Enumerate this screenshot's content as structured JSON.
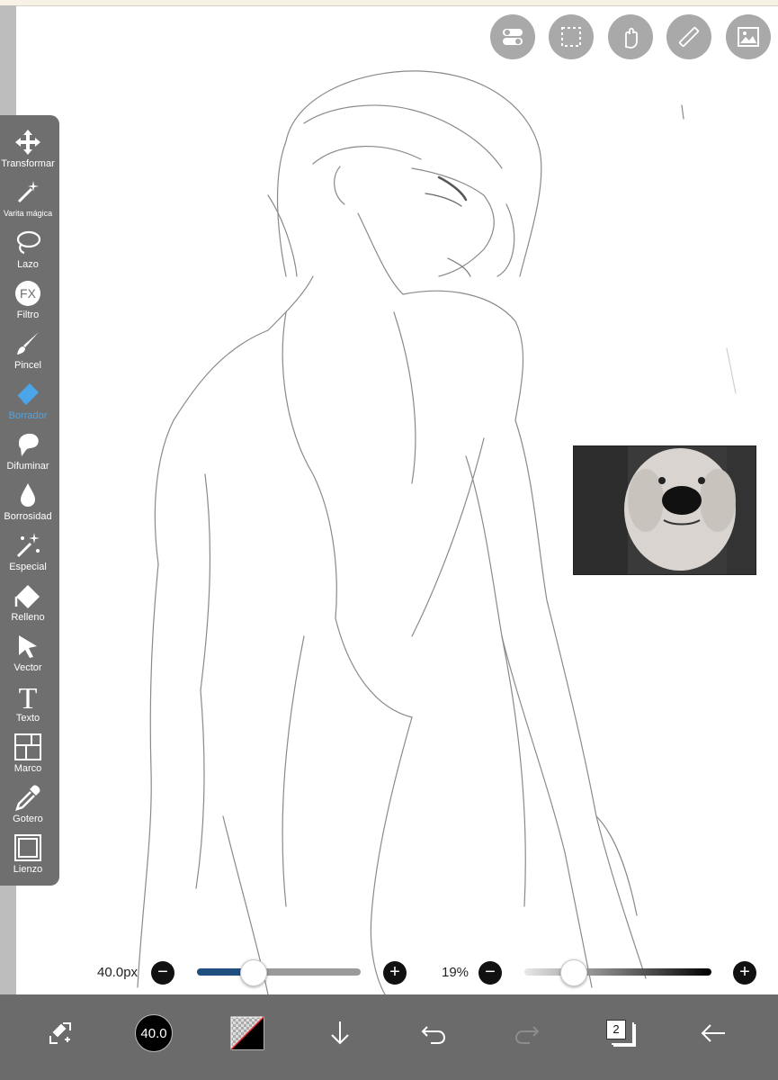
{
  "toolbar": {
    "tools": [
      {
        "label": "Transformar",
        "icon": "move-arrows-icon"
      },
      {
        "label": "Varita mágica",
        "icon": "magic-wand-icon"
      },
      {
        "label": "Lazo",
        "icon": "lasso-icon"
      },
      {
        "label": "Filtro",
        "icon": "fx-filter-icon",
        "glyph": "FX"
      },
      {
        "label": "Pincel",
        "icon": "brush-icon"
      },
      {
        "label": "Borrador",
        "icon": "eraser-icon",
        "active": true
      },
      {
        "label": "Difuminar",
        "icon": "smudge-icon"
      },
      {
        "label": "Borrosidad",
        "icon": "blur-drop-icon"
      },
      {
        "label": "Especial",
        "icon": "sparkle-icon"
      },
      {
        "label": "Relleno",
        "icon": "fill-bucket-icon"
      },
      {
        "label": "Vector",
        "icon": "vector-cursor-icon"
      },
      {
        "label": "Texto",
        "icon": "text-icon",
        "glyph": "T"
      },
      {
        "label": "Marco",
        "icon": "frame-icon"
      },
      {
        "label": "Gotero",
        "icon": "eyedropper-icon"
      },
      {
        "label": "Lienzo",
        "icon": "canvas-icon"
      }
    ],
    "active_color": "#4aa6e8"
  },
  "top_buttons": [
    {
      "name": "toggle-icon"
    },
    {
      "name": "selection-icon"
    },
    {
      "name": "gesture-hand-icon"
    },
    {
      "name": "ruler-icon"
    },
    {
      "name": "image-icon"
    }
  ],
  "brush": {
    "size_label": "40.0px",
    "size_fraction": 0.25,
    "opacity_label": "19%",
    "opacity_fraction": 0.19,
    "minus": "−",
    "plus": "+"
  },
  "bottom_bar": {
    "brush_size_disc": "40.0",
    "layer_count": "2",
    "icons": [
      "transform-arrows-icon",
      "brush-size-icon",
      "color-swatch-icon",
      "download-arrow-icon",
      "undo-icon",
      "redo-icon",
      "layers-icon",
      "back-arrow-icon"
    ]
  },
  "colors": {
    "toolbar_bg": "#6f6f6f",
    "bottom_bar_bg": "#6b6b6b",
    "slider_fill": "#1f4f7f"
  }
}
